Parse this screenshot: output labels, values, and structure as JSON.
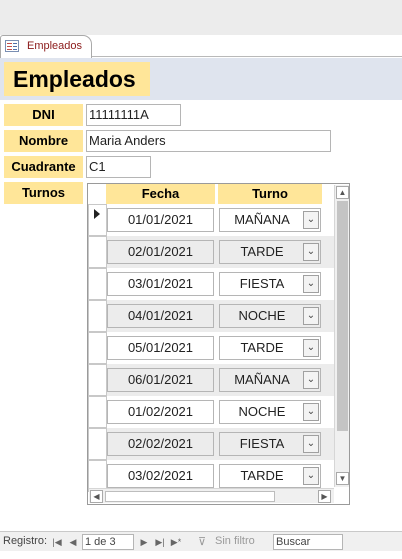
{
  "tab": {
    "label": "Empleados",
    "icon": "form-icon"
  },
  "form": {
    "title": "Empleados",
    "fields": {
      "dni": {
        "label": "DNI",
        "value": "11111111A"
      },
      "nombre": {
        "label": "Nombre",
        "value": "Maria Anders"
      },
      "cuadrante": {
        "label": "Cuadrante",
        "value": "C1"
      },
      "turnos": {
        "label": "Turnos"
      }
    }
  },
  "subform": {
    "columns": [
      "Fecha",
      "Turno"
    ],
    "rows": [
      {
        "fecha": "01/01/2021",
        "turno": "MAÑANA",
        "current": true
      },
      {
        "fecha": "02/01/2021",
        "turno": "TARDE"
      },
      {
        "fecha": "03/01/2021",
        "turno": "FIESTA"
      },
      {
        "fecha": "04/01/2021",
        "turno": "NOCHE"
      },
      {
        "fecha": "05/01/2021",
        "turno": "TARDE"
      },
      {
        "fecha": "06/01/2021",
        "turno": "MAÑANA"
      },
      {
        "fecha": "01/02/2021",
        "turno": "NOCHE"
      },
      {
        "fecha": "02/02/2021",
        "turno": "FIESTA"
      },
      {
        "fecha": "03/02/2021",
        "turno": "TARDE"
      }
    ]
  },
  "statusbar": {
    "registro_label": "Registro:",
    "record_position": "1 de 3",
    "filter_label": "Sin filtro",
    "search_placeholder": "Buscar"
  },
  "colors": {
    "label_bg": "#ffe699",
    "header_bg": "#dfe4ee",
    "alt_row": "#ececec"
  }
}
